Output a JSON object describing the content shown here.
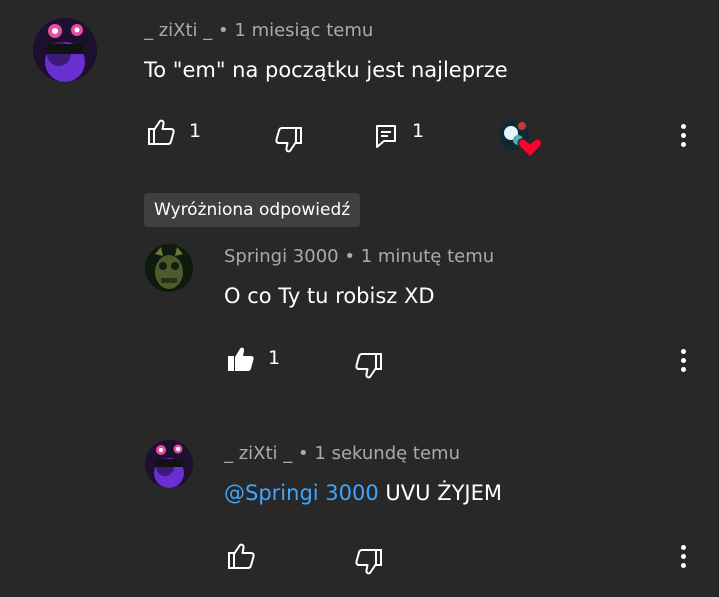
{
  "comment": {
    "author": "_ ziXti _",
    "sep": "•",
    "time": "1 miesiąc temu",
    "text": "To \"em\" na początku jest najleprze",
    "likes": "1",
    "replies": "1"
  },
  "badge": "Wyróżniona odpowiedź",
  "reply1": {
    "author": "Springi 3000",
    "sep": "•",
    "time": "1 minutę temu",
    "text": "O co Ty tu robisz XD",
    "likes": "1"
  },
  "reply2": {
    "author": "_ ziXti _",
    "sep": "•",
    "time": "1 sekundę temu",
    "mention": "@Springi 3000",
    "text": " UVU ŻYJEM"
  },
  "colors": {
    "background": "#282828",
    "meta_text": "#aaaaaa",
    "mention": "#3ea6ff",
    "heart": "#ff0033"
  }
}
